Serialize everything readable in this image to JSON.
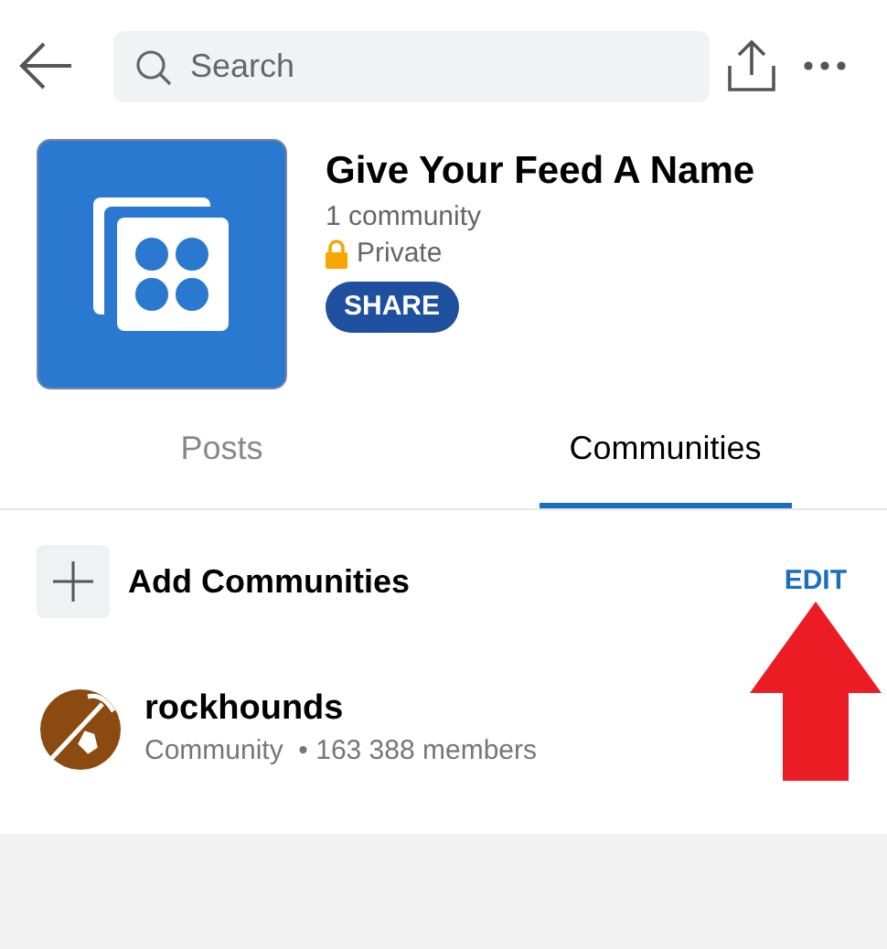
{
  "search": {
    "placeholder": "Search"
  },
  "feed": {
    "title": "Give Your Feed A Name",
    "count": "1 community",
    "privacy": "Private",
    "share_button": "SHARE"
  },
  "tabs": [
    {
      "label": "Posts",
      "selected": false
    },
    {
      "label": "Communities",
      "selected": true
    }
  ],
  "add_row": {
    "label": "Add Communities",
    "edit_button": "EDIT"
  },
  "communities": [
    {
      "name": "rockhounds",
      "type": "Community",
      "members": "• 163 388 members"
    }
  ]
}
